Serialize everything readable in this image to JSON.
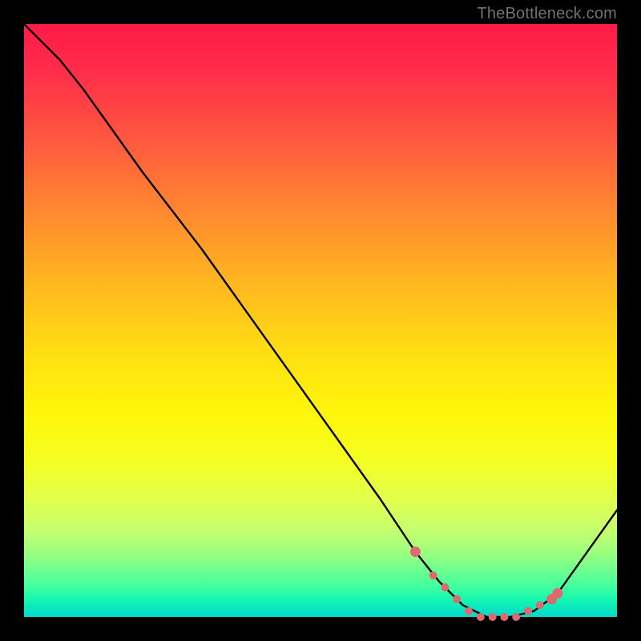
{
  "attribution": "TheBottleneck.com",
  "chart_data": {
    "type": "line",
    "title": "",
    "xlabel": "",
    "ylabel": "",
    "xlim": [
      0,
      100
    ],
    "ylim": [
      0,
      100
    ],
    "series": [
      {
        "name": "bottleneck-curve",
        "x": [
          0,
          6,
          10,
          20,
          30,
          40,
          50,
          60,
          66,
          70,
          74,
          78,
          82,
          86,
          90,
          100
        ],
        "y": [
          100,
          94,
          89,
          75,
          62,
          48,
          34,
          20,
          11,
          6,
          2,
          0,
          0,
          1,
          4,
          18
        ]
      }
    ],
    "markers": {
      "name": "highlight-range",
      "color": "#de6a6f",
      "x": [
        66,
        69,
        71,
        73,
        75,
        77,
        79,
        81,
        83,
        85,
        87,
        89,
        90
      ],
      "y": [
        11,
        7,
        5,
        3,
        1,
        0,
        0,
        0,
        0,
        1,
        2,
        3,
        4
      ]
    }
  }
}
